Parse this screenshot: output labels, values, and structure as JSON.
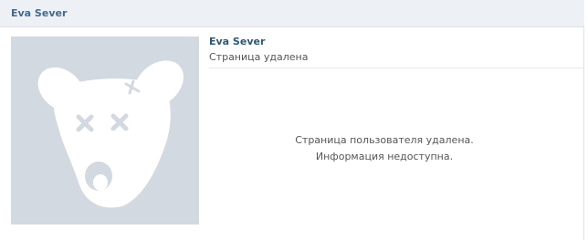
{
  "header": {
    "title": "Eva Sever"
  },
  "profile": {
    "name": "Eva Sever",
    "status": "Страница удалена",
    "avatar_icon": "deleted-dog-icon"
  },
  "notice": {
    "line1": "Страница пользователя удалена.",
    "line2": "Информация недоступна."
  },
  "colors": {
    "header_bg": "#edf1f5",
    "name_link": "#2b587a",
    "avatar_bg": "#d3d9e0"
  }
}
